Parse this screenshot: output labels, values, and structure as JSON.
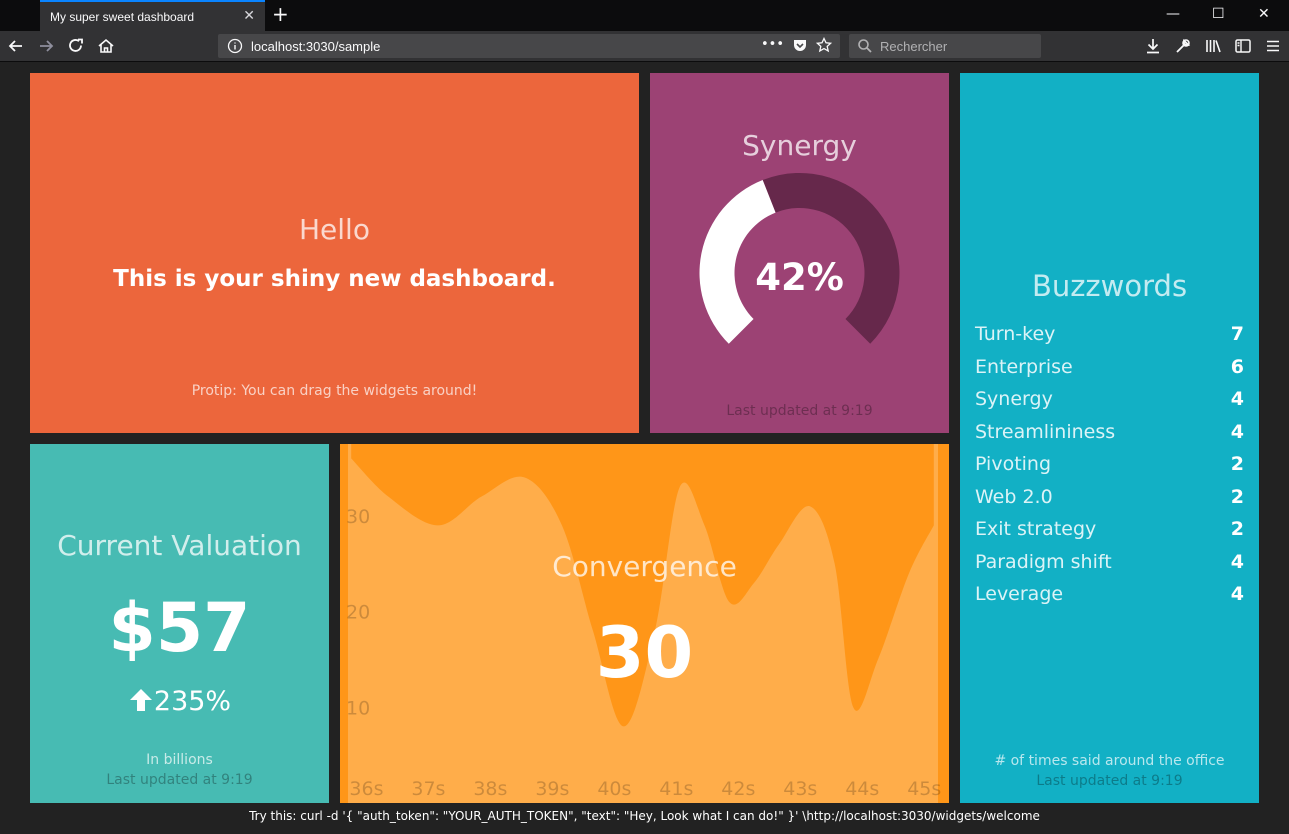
{
  "browser": {
    "tab_title": "My super sweet dashboard",
    "url": "localhost:3030/sample",
    "search_placeholder": "Rechercher",
    "url_actions": "•••"
  },
  "welcome": {
    "title": "Hello",
    "text": "This is your shiny new dashboard.",
    "more_info": "Protip: You can drag the widgets around!"
  },
  "synergy": {
    "title": "Synergy",
    "value_display": "42%",
    "value": 42,
    "updated": "Last updated at 9:19"
  },
  "buzzwords": {
    "title": "Buzzwords",
    "items": [
      {
        "label": "Turn-key",
        "value": "7"
      },
      {
        "label": "Enterprise",
        "value": "6"
      },
      {
        "label": "Synergy",
        "value": "4"
      },
      {
        "label": "Streamlininess",
        "value": "4"
      },
      {
        "label": "Pivoting",
        "value": "2"
      },
      {
        "label": "Web 2.0",
        "value": "2"
      },
      {
        "label": "Exit strategy",
        "value": "2"
      },
      {
        "label": "Paradigm shift",
        "value": "4"
      },
      {
        "label": "Leverage",
        "value": "4"
      }
    ],
    "more_info": "# of times said around the office",
    "updated": "Last updated at 9:19"
  },
  "valuation": {
    "title": "Current Valuation",
    "value": "$57",
    "change": "235%",
    "change_icon": "arrow-up-icon",
    "more_info": "In billions",
    "updated": "Last updated at 9:19"
  },
  "convergence": {
    "title": "Convergence",
    "value": "30"
  },
  "chart_data": {
    "type": "area",
    "x": [
      35.9,
      36.5,
      37.3,
      38,
      38.7,
      39.3,
      39.8,
      40.3,
      40.8,
      41.2,
      41.6,
      42,
      42.4,
      42.8,
      43.3,
      43.7,
      44,
      44.4,
      44.9,
      45.3
    ],
    "x_ticks": [
      "36s",
      "37s",
      "38s",
      "39s",
      "40s",
      "41s",
      "42s",
      "43s",
      "44s",
      "45s"
    ],
    "y": [
      36,
      32,
      29,
      32,
      34,
      29,
      18,
      8,
      18,
      33,
      29,
      21,
      23,
      27,
      31,
      25,
      10,
      15,
      24,
      29
    ],
    "y_ticks": [
      "10",
      "20",
      "30"
    ],
    "ylim": [
      0,
      37.5
    ],
    "xlim": [
      35.8,
      45.4
    ]
  },
  "footer": {
    "text": "Try this: curl -d '{ \"auth_token\": \"YOUR_AUTH_TOKEN\", \"text\": \"Hey, Look what I can do!\" }' \\http://localhost:3030/widgets/welcome"
  },
  "colors": {
    "welcome": "#ec663c",
    "synergy": "#9c4274",
    "buzzwords": "#12b0c5",
    "valuation": "#47bbb3",
    "convergence": "#ff9618",
    "background": "#222222"
  }
}
